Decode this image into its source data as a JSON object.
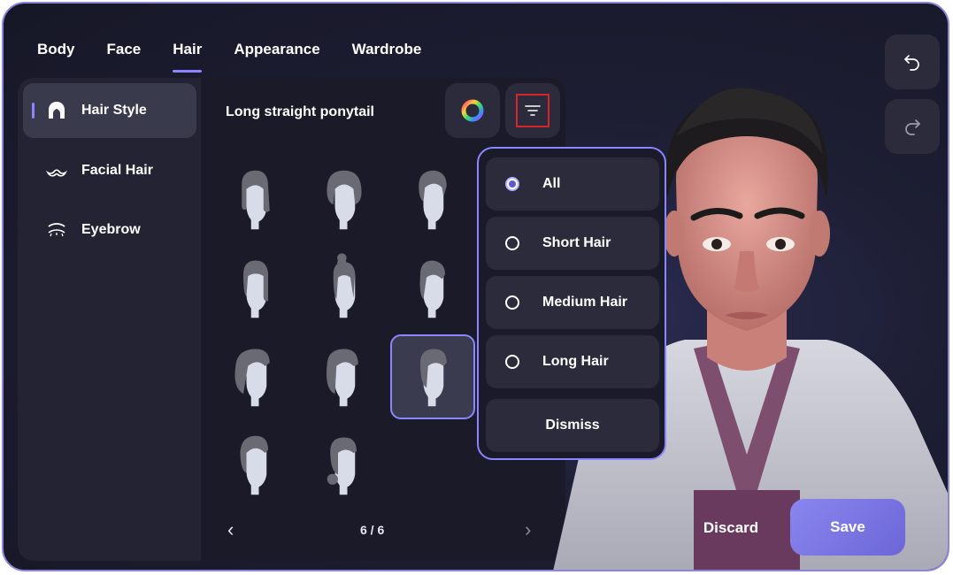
{
  "tabs": [
    {
      "label": "Body"
    },
    {
      "label": "Face"
    },
    {
      "label": "Hair"
    },
    {
      "label": "Appearance"
    },
    {
      "label": "Wardrobe"
    }
  ],
  "active_tab": "Hair",
  "sidebar": {
    "items": [
      {
        "label": "Hair Style",
        "icon": "hair-style-icon",
        "active": true
      },
      {
        "label": "Facial Hair",
        "icon": "mustache-icon",
        "active": false
      },
      {
        "label": "Eyebrow",
        "icon": "eyebrow-icon",
        "active": false
      }
    ]
  },
  "panel": {
    "title": "Long straight ponytail",
    "color_button_icon": "color-wheel-icon",
    "filter_button_icon": "filter-icon",
    "styles_count": 11,
    "selected_index": 8
  },
  "pager": {
    "label": "6 / 6",
    "prev_icon": "chevron-left-icon",
    "next_icon": "chevron-right-icon"
  },
  "filter_menu": {
    "options": [
      {
        "label": "All",
        "selected": true
      },
      {
        "label": "Short Hair",
        "selected": false
      },
      {
        "label": "Medium Hair",
        "selected": false
      },
      {
        "label": "Long Hair",
        "selected": false
      }
    ],
    "dismiss_label": "Dismiss"
  },
  "actions": {
    "undo_icon": "undo-icon",
    "redo_icon": "redo-icon",
    "discard_label": "Discard",
    "save_label": "Save"
  },
  "colors": {
    "accent": "#8b86ff",
    "window_border": "#8a86d8",
    "save_button": "#7a75e3",
    "highlight_box": "#d6242a"
  }
}
